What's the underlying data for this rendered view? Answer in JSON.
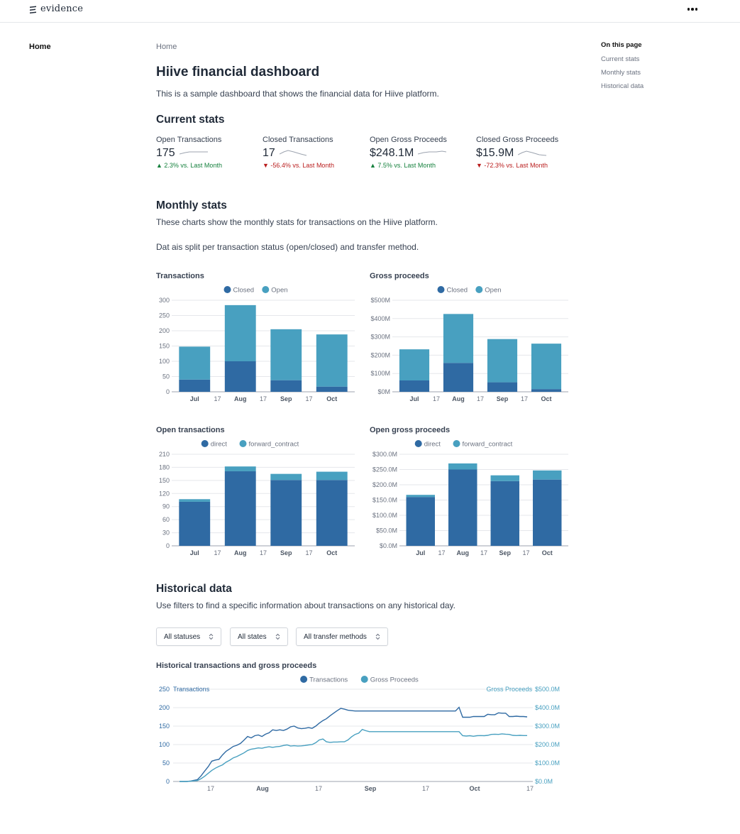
{
  "app": {
    "logo_text": "evidence"
  },
  "colors": {
    "dark": "#2f6aa3",
    "light": "#48a0c0",
    "up": "#15803d",
    "down": "#b91c1c",
    "grid": "#e5e7eb"
  },
  "nav": {
    "home": "Home"
  },
  "breadcrumb": "Home",
  "page": {
    "title": "Hiive financial dashboard",
    "intro": "This is a sample dashboard that shows the financial data for Hiive platform."
  },
  "current_stats": {
    "heading": "Current stats",
    "kpis": [
      {
        "label": "Open Transactions",
        "value": "175",
        "delta": "▲ 2.3% vs. Last Month",
        "direction": "up"
      },
      {
        "label": "Closed Transactions",
        "value": "17",
        "delta": "▼ -56.4% vs. Last Month",
        "direction": "down"
      },
      {
        "label": "Open Gross Proceeds",
        "value": "$248.1M",
        "delta": "▲ 7.5% vs. Last Month",
        "direction": "up"
      },
      {
        "label": "Closed Gross Proceeds",
        "value": "$15.9M",
        "delta": "▼ -72.3% vs. Last Month",
        "direction": "down"
      }
    ]
  },
  "monthly_stats": {
    "heading": "Monthly stats",
    "para1": "These charts show the monthly stats for transactions on the Hiive platform.",
    "para2": "Dat ais split per transaction status (open/closed) and transfer method."
  },
  "historical": {
    "heading": "Historical data",
    "para": "Use filters to find a specific information about transactions on any historical day.",
    "filters": [
      "All statuses",
      "All states",
      "All transfer methods"
    ]
  },
  "toc": {
    "title": "On this page",
    "links": [
      "Current stats",
      "Monthly stats",
      "Historical data"
    ]
  },
  "chart_data": [
    {
      "type": "bar",
      "title": "Transactions",
      "stacked": true,
      "categories": [
        "Jul",
        "Aug",
        "Sep",
        "Oct"
      ],
      "x_ticks": [
        "Jul",
        "17",
        "Aug",
        "17",
        "Sep",
        "17",
        "Oct"
      ],
      "series": [
        {
          "name": "Closed",
          "values": [
            40,
            100,
            38,
            17
          ]
        },
        {
          "name": "Open",
          "values": [
            108,
            184,
            167,
            171
          ]
        }
      ],
      "ylim": [
        0,
        300
      ],
      "y_ticks": [
        "0",
        "50",
        "100",
        "150",
        "200",
        "250",
        "300"
      ],
      "legend": "top-center",
      "grid": true
    },
    {
      "type": "bar",
      "title": "Gross proceeds",
      "stacked": true,
      "categories": [
        "Jul",
        "Aug",
        "Sep",
        "Oct"
      ],
      "x_ticks": [
        "Jul",
        "17",
        "Aug",
        "17",
        "Sep",
        "17",
        "Oct"
      ],
      "series": [
        {
          "name": "Closed",
          "values": [
            62,
            158,
            52,
            15
          ]
        },
        {
          "name": "Open",
          "values": [
            170,
            267,
            236,
            248
          ]
        }
      ],
      "ylim": [
        0,
        500
      ],
      "y_ticks": [
        "$0M",
        "$100M",
        "$200M",
        "$300M",
        "$400M",
        "$500M"
      ],
      "legend": "top-center",
      "grid": true
    },
    {
      "type": "bar",
      "title": "Open transactions",
      "stacked": true,
      "categories": [
        "Jul",
        "Aug",
        "Sep",
        "Oct"
      ],
      "x_ticks": [
        "Jul",
        "17",
        "Aug",
        "17",
        "Sep",
        "17",
        "Oct"
      ],
      "series": [
        {
          "name": "direct",
          "values": [
            101,
            171,
            151,
            151
          ]
        },
        {
          "name": "forward_contract",
          "values": [
            6,
            11,
            14,
            19
          ]
        }
      ],
      "ylim": [
        0,
        210
      ],
      "y_ticks": [
        "0",
        "30",
        "60",
        "90",
        "120",
        "150",
        "180",
        "210"
      ],
      "legend": "top-center",
      "grid": true
    },
    {
      "type": "bar",
      "title": "Open gross proceeds",
      "stacked": true,
      "categories": [
        "Jul",
        "Aug",
        "Sep",
        "Oct"
      ],
      "x_ticks": [
        "Jul",
        "17",
        "Aug",
        "17",
        "Sep",
        "17",
        "Oct"
      ],
      "series": [
        {
          "name": "direct",
          "values": [
            160,
            250,
            212,
            217
          ]
        },
        {
          "name": "forward_contract",
          "values": [
            7,
            20,
            19,
            30
          ]
        }
      ],
      "ylim": [
        0,
        300
      ],
      "y_ticks": [
        "$0.0M",
        "$50.0M",
        "$100.0M",
        "$150.0M",
        "$200.0M",
        "$250.0M",
        "$300.0M"
      ],
      "legend": "top-center",
      "grid": true
    },
    {
      "type": "line",
      "title": "Historical transactions and gross proceeds",
      "x_ticks": [
        "17",
        "Aug",
        "17",
        "Sep",
        "17",
        "Oct",
        "17"
      ],
      "y_left_label": "Transactions",
      "y_right_label": "Gross Proceeds",
      "y_left_ticks": [
        "0",
        "50",
        "100",
        "150",
        "200",
        "250"
      ],
      "y_right_ticks": [
        "$0.0M",
        "$100.0M",
        "$200.0M",
        "$300.0M",
        "$400.0M",
        "$500.0M"
      ],
      "ylim_left": [
        0,
        250
      ],
      "ylim_right": [
        0,
        500
      ],
      "legend": "top-center",
      "grid": true,
      "series": [
        {
          "name": "Transactions",
          "axis": "left",
          "values": [
            0,
            0,
            0,
            1,
            3,
            5,
            15,
            28,
            40,
            55,
            58,
            60,
            72,
            82,
            88,
            95,
            98,
            103,
            112,
            122,
            118,
            124,
            126,
            122,
            128,
            132,
            140,
            138,
            140,
            138,
            142,
            148,
            150,
            145,
            143,
            144,
            146,
            144,
            150,
            158,
            165,
            170,
            178,
            185,
            192,
            198,
            196,
            193,
            192,
            191,
            191,
            191,
            191,
            191,
            191,
            191,
            191,
            191,
            191,
            191,
            191,
            191,
            191,
            191,
            191,
            191,
            191,
            191,
            191,
            191,
            191,
            191,
            191,
            191,
            191,
            191,
            191,
            191,
            201,
            174,
            174,
            174,
            176,
            176,
            176,
            176,
            182,
            181,
            181,
            186,
            185,
            185,
            176,
            176,
            177,
            176,
            176,
            175
          ]
        },
        {
          "name": "Gross Proceeds",
          "axis": "right",
          "values": [
            0,
            0,
            0,
            1,
            3,
            5,
            15,
            28,
            44,
            60,
            72,
            82,
            90,
            105,
            115,
            128,
            135,
            145,
            155,
            168,
            175,
            178,
            182,
            180,
            185,
            188,
            185,
            188,
            190,
            195,
            198,
            192,
            194,
            192,
            193,
            195,
            198,
            200,
            210,
            225,
            230,
            215,
            212,
            214,
            214,
            215,
            215,
            225,
            242,
            255,
            262,
            282,
            275,
            270,
            270,
            270,
            270,
            270,
            270,
            270,
            270,
            270,
            270,
            270,
            270,
            270,
            270,
            270,
            270,
            270,
            270,
            270,
            270,
            270,
            270,
            270,
            270,
            270,
            270,
            248,
            246,
            248,
            245,
            248,
            249,
            248,
            250,
            255,
            256,
            255,
            258,
            256,
            255,
            250,
            249,
            250,
            249,
            249
          ]
        }
      ]
    }
  ]
}
